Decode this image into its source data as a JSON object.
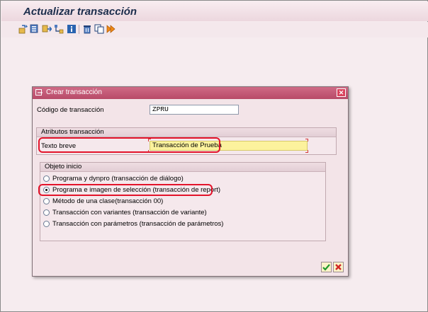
{
  "app": {
    "title": "Actualizar transacción"
  },
  "toolbar": {
    "buttons": [
      {
        "name": "other-object-icon"
      },
      {
        "name": "display-object-icon"
      },
      {
        "name": "object-list-icon"
      },
      {
        "name": "where-used-icon"
      },
      {
        "name": "info-icon"
      },
      {
        "name": "delete-icon"
      },
      {
        "name": "copy-icon"
      },
      {
        "name": "test-icon"
      }
    ]
  },
  "dialog": {
    "title": "Crear transacción",
    "tcode_label": "Código de transacción",
    "tcode_value": "ZPRU",
    "attributes_group": "Atributos transacción",
    "short_text_label": "Texto breve",
    "short_text_value": "Transacción de Prueba",
    "start_object_group": "Objeto inicio",
    "options": [
      {
        "label": "Programa y dynpro (transacción de diálogo)",
        "selected": false
      },
      {
        "label": "Programa e imagen de selección (transacción de report)",
        "selected": true
      },
      {
        "label": "Método de una clase(transacción 00)",
        "selected": false
      },
      {
        "label": "Transacción con variantes (transacción de variante)",
        "selected": false
      },
      {
        "label": "Transacción con parámetros (transacción de parámetros)",
        "selected": false
      }
    ],
    "ok_icon": "check-icon",
    "cancel_icon": "cancel-x-icon"
  },
  "colors": {
    "title_bar": "#b84a68",
    "highlight": "#e3142b",
    "input_yellow": "#fcf29d"
  }
}
